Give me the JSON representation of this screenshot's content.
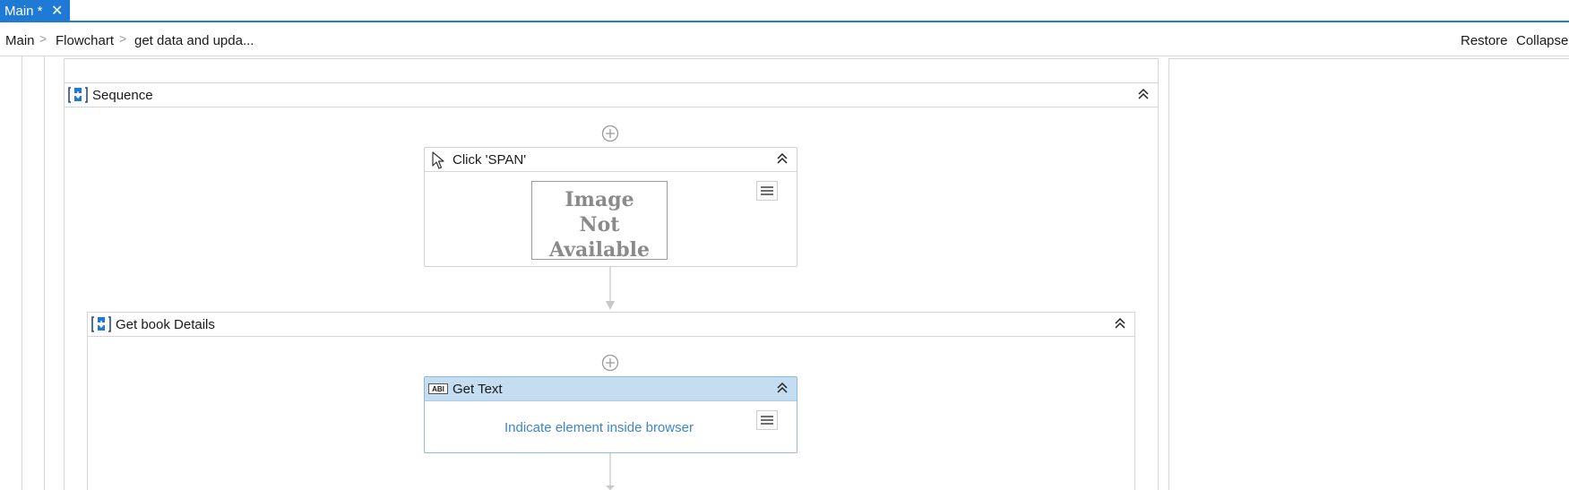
{
  "tab": {
    "label": "Main *",
    "close": "✕"
  },
  "breadcrumb": {
    "items": [
      "Main",
      "Flowchart",
      "get data and upda..."
    ],
    "separator": ">"
  },
  "toolbar": {
    "restore_label": "Restore",
    "collapse_label": "Collapse"
  },
  "sequence": {
    "title": "Sequence"
  },
  "click_activity": {
    "title": "Click 'SPAN'",
    "image_placeholder": [
      "Image",
      "Not",
      "Available"
    ]
  },
  "book_sequence": {
    "title": "Get book Details"
  },
  "get_text_activity": {
    "title": "Get Text",
    "icon_text": "ABI",
    "prompt": "Indicate element inside browser"
  },
  "colors": {
    "accent": "#1f7ad6",
    "selected_header": "#c4ddf1",
    "link": "#3f86c9"
  }
}
